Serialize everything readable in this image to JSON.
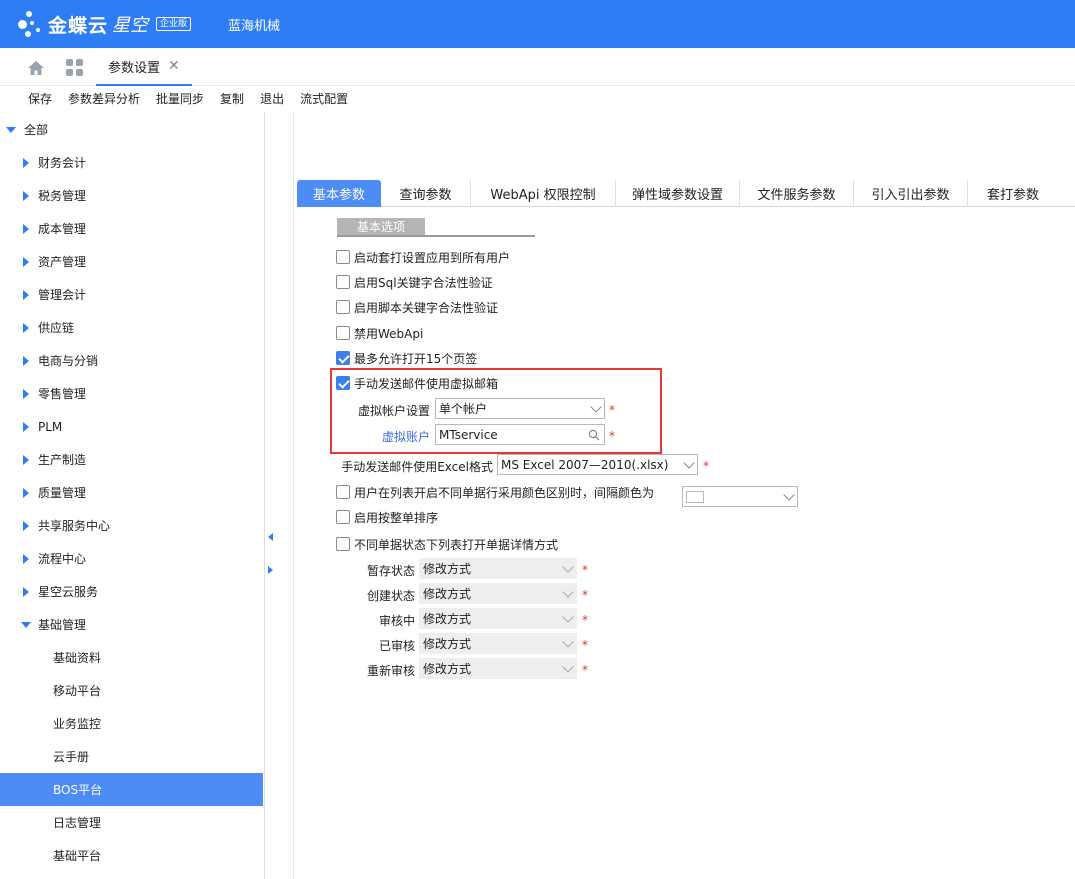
{
  "brand": {
    "logo": "金蝶云",
    "logo_sub": "星空",
    "edition": "企业版",
    "company": "蓝海机械"
  },
  "tabs": {
    "home_icon": "home-icon",
    "apps_icon": "grid-icon",
    "active_tab": "参数设置",
    "close": "✕"
  },
  "toolbar": {
    "items": [
      "保存",
      "参数差异分析",
      "批量同步",
      "复制",
      "退出",
      "流式配置"
    ]
  },
  "sidebar": {
    "root": "全部",
    "items": [
      "财务会计",
      "税务管理",
      "成本管理",
      "资产管理",
      "管理会计",
      "供应链",
      "电商与分销",
      "零售管理",
      "PLM",
      "生产制造",
      "质量管理",
      "共享服务中心",
      "流程中心",
      "星空云服务",
      "基础管理"
    ],
    "children": [
      "基础资料",
      "移动平台",
      "业务监控",
      "云手册",
      "BOS平台",
      "日志管理",
      "基础平台"
    ],
    "selected": "BOS平台"
  },
  "param_tabs": [
    "基本参数",
    "查询参数",
    "WebApi 权限控制",
    "弹性域参数设置",
    "文件服务参数",
    "引入引出参数",
    "套打参数"
  ],
  "section_title": "基本选项",
  "options": {
    "apply_print_all": {
      "label": "启动套打设置应用到所有用户",
      "checked": false
    },
    "sql_keyword": {
      "label": "启用Sql关键字合法性验证",
      "checked": false
    },
    "script_keyword": {
      "label": "启用脚本关键字合法性验证",
      "checked": false
    },
    "disable_webapi": {
      "label": "禁用WebApi",
      "checked": false
    },
    "max_tabs": {
      "label": "最多允许打开15个页签",
      "checked": true
    },
    "virtual_mail": {
      "label": "手动发送邮件使用虚拟邮箱",
      "checked": true
    },
    "row_color": {
      "label": "用户在列表开启不同单据行采用颜色区别时，间隔颜色为",
      "checked": false
    },
    "sort_whole": {
      "label": "启用按整单排序",
      "checked": false
    },
    "status_open": {
      "label": "不同单据状态下列表打开单据详情方式",
      "checked": false
    }
  },
  "virtual_account_setting": {
    "label": "虚拟帐户设置",
    "value": "单个帐户"
  },
  "virtual_account": {
    "label": "虚拟账户",
    "value": "MTservice"
  },
  "excel_format": {
    "label": "手动发送邮件使用Excel格式",
    "value": "MS Excel 2007—2010(.xlsx)"
  },
  "status_rows": [
    {
      "label": "暂存状态",
      "value": "修改方式"
    },
    {
      "label": "创建状态",
      "value": "修改方式"
    },
    {
      "label": "审核中",
      "value": "修改方式"
    },
    {
      "label": "已审核",
      "value": "修改方式"
    },
    {
      "label": "重新审核",
      "value": "修改方式"
    }
  ],
  "required_mark": "*",
  "colors": {
    "brand": "#2f7df5",
    "selected": "#4d8cf5",
    "highlight": "#e53935",
    "required": "#e5322d"
  }
}
